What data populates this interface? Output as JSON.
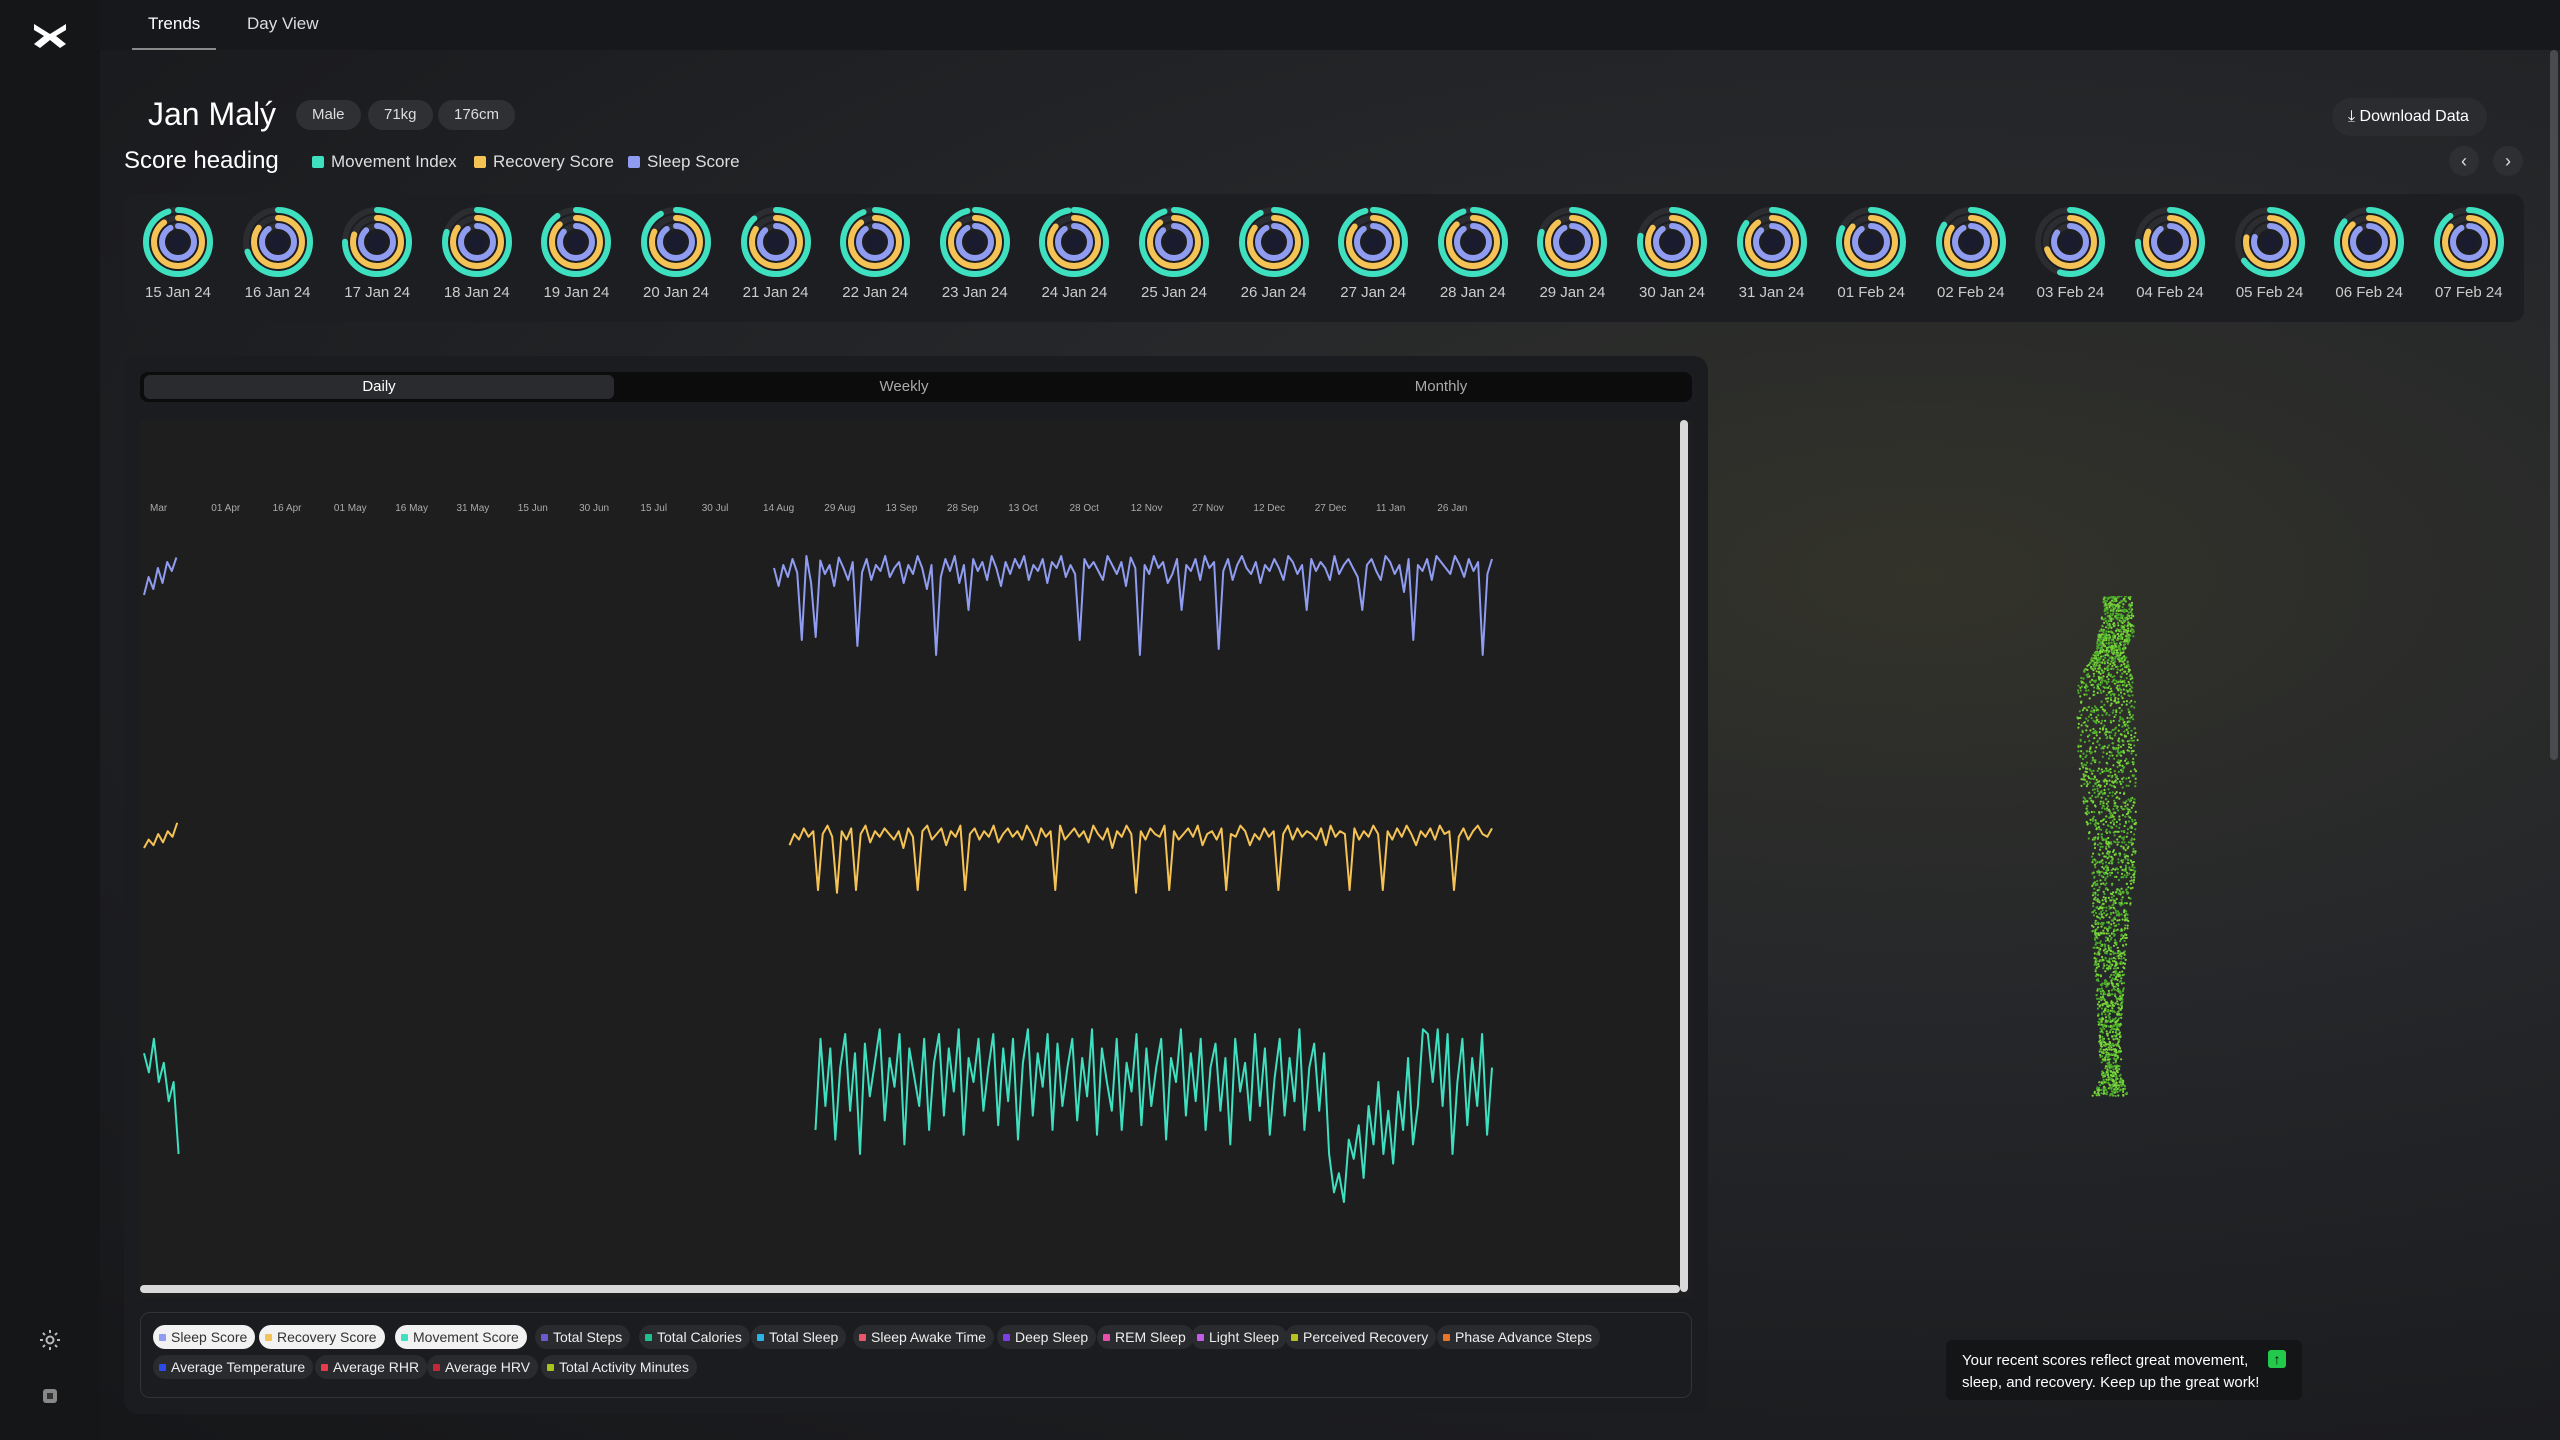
{
  "tabs": [
    "Trends",
    "Day View"
  ],
  "user": {
    "name": "Jan Malý",
    "chips": [
      "Male",
      "71kg",
      "176cm"
    ]
  },
  "download_label": "Download Data",
  "score_heading": "Score heading",
  "legend": [
    {
      "label": "Movement Index",
      "color": "#3fe0c0"
    },
    {
      "label": "Recovery Score",
      "color": "#f5c355"
    },
    {
      "label": "Sleep Score",
      "color": "#8f9cf0"
    }
  ],
  "rings": [
    {
      "date": "15 Jan 24",
      "movement": 0.95,
      "recovery": 0.9,
      "sleep": 0.92
    },
    {
      "date": "16 Jan 24",
      "movement": 0.7,
      "recovery": 0.85,
      "sleep": 0.9
    },
    {
      "date": "17 Jan 24",
      "movement": 0.75,
      "recovery": 0.8,
      "sleep": 0.88
    },
    {
      "date": "18 Jan 24",
      "movement": 0.8,
      "recovery": 0.85,
      "sleep": 0.9
    },
    {
      "date": "19 Jan 24",
      "movement": 0.9,
      "recovery": 0.88,
      "sleep": 0.86
    },
    {
      "date": "20 Jan 24",
      "movement": 0.92,
      "recovery": 0.82,
      "sleep": 0.9
    },
    {
      "date": "21 Jan 24",
      "movement": 0.88,
      "recovery": 0.84,
      "sleep": 0.88
    },
    {
      "date": "22 Jan 24",
      "movement": 0.94,
      "recovery": 0.9,
      "sleep": 0.9
    },
    {
      "date": "23 Jan 24",
      "movement": 0.96,
      "recovery": 0.88,
      "sleep": 0.92
    },
    {
      "date": "24 Jan 24",
      "movement": 0.97,
      "recovery": 0.86,
      "sleep": 0.9
    },
    {
      "date": "25 Jan 24",
      "movement": 0.95,
      "recovery": 0.9,
      "sleep": 0.88
    },
    {
      "date": "26 Jan 24",
      "movement": 0.93,
      "recovery": 0.85,
      "sleep": 0.92
    },
    {
      "date": "27 Jan 24",
      "movement": 0.96,
      "recovery": 0.86,
      "sleep": 0.9
    },
    {
      "date": "28 Jan 24",
      "movement": 0.95,
      "recovery": 0.88,
      "sleep": 0.9
    },
    {
      "date": "29 Jan 24",
      "movement": 0.8,
      "recovery": 0.9,
      "sleep": 0.92
    },
    {
      "date": "30 Jan 24",
      "movement": 0.78,
      "recovery": 0.85,
      "sleep": 0.9
    },
    {
      "date": "31 Jan 24",
      "movement": 0.85,
      "recovery": 0.9,
      "sleep": 0.88
    },
    {
      "date": "01 Feb 24",
      "movement": 0.82,
      "recovery": 0.86,
      "sleep": 0.9
    },
    {
      "date": "02 Feb 24",
      "movement": 0.84,
      "recovery": 0.85,
      "sleep": 0.92
    },
    {
      "date": "03 Feb 24",
      "movement": 0.55,
      "recovery": 0.7,
      "sleep": 0.85
    },
    {
      "date": "04 Feb 24",
      "movement": 0.75,
      "recovery": 0.82,
      "sleep": 0.9
    },
    {
      "date": "05 Feb 24",
      "movement": 0.65,
      "recovery": 0.78,
      "sleep": 0.8
    },
    {
      "date": "06 Feb 24",
      "movement": 0.86,
      "recovery": 0.88,
      "sleep": 0.9
    },
    {
      "date": "07 Feb 24",
      "movement": 0.9,
      "recovery": 0.86,
      "sleep": 0.92
    }
  ],
  "period_tabs": [
    "Daily",
    "Weekly",
    "Monthly"
  ],
  "chart_data": {
    "type": "line",
    "x_ticks": [
      "Mar",
      "01 Apr",
      "16 Apr",
      "01 May",
      "16 May",
      "31 May",
      "15 Jun",
      "30 Jun",
      "15 Jul",
      "30 Jul",
      "14 Aug",
      "29 Aug",
      "13 Sep",
      "28 Sep",
      "13 Oct",
      "28 Oct",
      "12 Nov",
      "27 Nov",
      "12 Dec",
      "27 Dec",
      "11 Jan",
      "26 Jan"
    ],
    "series": [
      {
        "name": "Sleep Score",
        "color": "#8f9cf0",
        "values": [
          70,
          82,
          74,
          88,
          78,
          92,
          86,
          95,
          null,
          null,
          null,
          null,
          null,
          null,
          null,
          null,
          null,
          null,
          null,
          null,
          null,
          null,
          null,
          null,
          null,
          null,
          null,
          null,
          null,
          null,
          null,
          null,
          null,
          null,
          null,
          null,
          null,
          null,
          null,
          null,
          null,
          null,
          null,
          null,
          null,
          null,
          null,
          null,
          null,
          null,
          null,
          null,
          null,
          null,
          null,
          null,
          null,
          null,
          null,
          null,
          null,
          null,
          null,
          null,
          null,
          null,
          null,
          null,
          null,
          null,
          null,
          null,
          null,
          null,
          null,
          null,
          null,
          null,
          null,
          null,
          null,
          null,
          null,
          null,
          null,
          null,
          null,
          null,
          null,
          null,
          null,
          null,
          null,
          null,
          null,
          null,
          null,
          null,
          null,
          null,
          null,
          null,
          null,
          null,
          null,
          null,
          null,
          null,
          null,
          null,
          null,
          null,
          null,
          null,
          null,
          null,
          null,
          null,
          null,
          null,
          null,
          null,
          null,
          null,
          null,
          null,
          null,
          null,
          null,
          null,
          null,
          null,
          null,
          null,
          null,
          null,
          88,
          76,
          90,
          82,
          94,
          85,
          40,
          96,
          78,
          42,
          93,
          84,
          90,
          76,
          95,
          88,
          80,
          92,
          36,
          85,
          94,
          80,
          90,
          86,
          96,
          82,
          88,
          92,
          78,
          90,
          84,
          96,
          88,
          74,
          90,
          30,
          82,
          94,
          86,
          96,
          78,
          90,
          60,
          94,
          86,
          92,
          80,
          96,
          88,
          76,
          92,
          84,
          94,
          88,
          96,
          80,
          90,
          86,
          94,
          78,
          92,
          88,
          96,
          82,
          90,
          84,
          40,
          94,
          88,
          92,
          86,
          80,
          96,
          90,
          84,
          92,
          76,
          95,
          88,
          30,
          90,
          84,
          96,
          88,
          92,
          78,
          84,
          94,
          60,
          90,
          86,
          94,
          80,
          96,
          88,
          92,
          34,
          86,
          94,
          80,
          90,
          96,
          88,
          84,
          92,
          78,
          90,
          86,
          94,
          88,
          80,
          96,
          92,
          84,
          90,
          60,
          94,
          86,
          92,
          88,
          80,
          96,
          84,
          90,
          94,
          88,
          82,
          60,
          90,
          94,
          86,
          80,
          96,
          92,
          84,
          90,
          72,
          94,
          40,
          90,
          86,
          94,
          80,
          96,
          92,
          88,
          84,
          96,
          90,
          82,
          94,
          86,
          92,
          30,
          84,
          94
        ]
      },
      {
        "name": "Recovery Score",
        "color": "#f5c355",
        "values": [
          60,
          66,
          62,
          70,
          64,
          72,
          68,
          78,
          null,
          null,
          null,
          null,
          null,
          null,
          null,
          null,
          null,
          null,
          null,
          null,
          null,
          null,
          null,
          null,
          null,
          null,
          null,
          null,
          null,
          null,
          null,
          null,
          null,
          null,
          null,
          null,
          null,
          null,
          null,
          null,
          null,
          null,
          null,
          null,
          null,
          null,
          null,
          null,
          null,
          null,
          null,
          null,
          null,
          null,
          null,
          null,
          null,
          null,
          null,
          null,
          null,
          null,
          null,
          null,
          null,
          null,
          null,
          null,
          null,
          null,
          null,
          null,
          null,
          null,
          null,
          null,
          null,
          null,
          null,
          null,
          null,
          null,
          null,
          null,
          null,
          null,
          null,
          null,
          null,
          null,
          null,
          null,
          null,
          null,
          null,
          null,
          null,
          null,
          null,
          null,
          null,
          null,
          null,
          null,
          null,
          null,
          null,
          null,
          null,
          null,
          null,
          null,
          null,
          null,
          null,
          null,
          null,
          null,
          null,
          null,
          null,
          null,
          null,
          null,
          null,
          null,
          null,
          null,
          null,
          null,
          null,
          null,
          null,
          null,
          null,
          null,
          62,
          70,
          66,
          74,
          68,
          72,
          30,
          70,
          76,
          68,
          28,
          72,
          66,
          74,
          30,
          70,
          76,
          64,
          72,
          68,
          74,
          70,
          66,
          72,
          60,
          74,
          68,
          30,
          72,
          76,
          66,
          70,
          74,
          62,
          72,
          68,
          76,
          30,
          70,
          74,
          66,
          72,
          68,
          76,
          64,
          70,
          74,
          68,
          72,
          66,
          76,
          70,
          62,
          74,
          68,
          72,
          30,
          76,
          66,
          70,
          74,
          68,
          72,
          64,
          76,
          70,
          66,
          74,
          60,
          72,
          68,
          76,
          70,
          28,
          72,
          66,
          74,
          70,
          68,
          76,
          30,
          72,
          66,
          70,
          74,
          68,
          76,
          62,
          70,
          72,
          66,
          74,
          30,
          70,
          68,
          76,
          72,
          62,
          70,
          66,
          74,
          68,
          72,
          30,
          70,
          76,
          66,
          74,
          68,
          72,
          70,
          66,
          74,
          62,
          76,
          68,
          72,
          70,
          30,
          74,
          66,
          72,
          68,
          76,
          70,
          30,
          72,
          66,
          74,
          68,
          76,
          70,
          62,
          72,
          68,
          74,
          66,
          76,
          70,
          72,
          30,
          68,
          74,
          66,
          72,
          76,
          70,
          68,
          74
        ]
      },
      {
        "name": "Movement Score",
        "color": "#3fe0c0",
        "values": [
          82,
          74,
          88,
          70,
          78,
          62,
          70,
          40,
          null,
          null,
          null,
          null,
          null,
          null,
          null,
          null,
          null,
          null,
          null,
          null,
          null,
          null,
          null,
          null,
          null,
          null,
          null,
          null,
          null,
          null,
          null,
          null,
          null,
          null,
          null,
          null,
          null,
          null,
          null,
          null,
          null,
          null,
          null,
          null,
          null,
          null,
          null,
          null,
          null,
          null,
          null,
          null,
          null,
          null,
          null,
          null,
          null,
          null,
          null,
          null,
          null,
          null,
          null,
          null,
          null,
          null,
          null,
          null,
          null,
          null,
          null,
          null,
          null,
          null,
          null,
          null,
          null,
          null,
          null,
          null,
          null,
          null,
          null,
          null,
          null,
          null,
          null,
          null,
          null,
          null,
          null,
          null,
          null,
          null,
          null,
          null,
          null,
          null,
          null,
          null,
          null,
          null,
          null,
          null,
          null,
          null,
          null,
          null,
          null,
          null,
          null,
          null,
          null,
          null,
          null,
          null,
          null,
          null,
          null,
          null,
          null,
          null,
          null,
          null,
          null,
          null,
          null,
          null,
          null,
          null,
          null,
          null,
          null,
          null,
          null,
          null,
          50,
          88,
          60,
          84,
          46,
          76,
          90,
          58,
          82,
          40,
          86,
          64,
          78,
          92,
          54,
          80,
          68,
          90,
          44,
          84,
          72,
          60,
          88,
          50,
          78,
          90,
          56,
          84,
          66,
          92,
          48,
          80,
          70,
          88,
          58,
          76,
          90,
          52,
          84,
          62,
          88,
          46,
          78,
          92,
          56,
          82,
          68,
          90,
          50,
          86,
          60,
          76,
          88,
          54,
          80,
          64,
          92,
          48,
          84,
          70,
          58,
          88,
          50,
          78,
          66,
          90,
          52,
          84,
          60,
          76,
          88,
          46,
          80,
          70,
          92,
          56,
          82,
          62,
          88,
          50,
          76,
          86,
          58,
          80,
          44,
          88,
          66,
          78,
          54,
          90,
          60,
          84,
          48,
          72,
          88,
          56,
          80,
          62,
          92,
          50,
          76,
          86,
          58,
          82,
          40,
          24,
          32,
          20,
          46,
          38,
          52,
          30,
          60,
          44,
          70,
          40,
          58,
          36,
          66,
          50,
          80,
          44,
          60,
          92,
          90,
          70,
          92,
          60,
          90,
          40,
          70,
          88,
          52,
          80,
          60,
          90,
          48,
          76
        ]
      }
    ]
  },
  "metrics": [
    {
      "label": "Sleep Score",
      "color": "#8f9cf0",
      "on": true
    },
    {
      "label": "Recovery Score",
      "color": "#f5c355",
      "on": true
    },
    {
      "label": "Movement Score",
      "color": "#3fe0c0",
      "on": true
    },
    {
      "label": "Total Steps",
      "color": "#6a5acd",
      "on": false
    },
    {
      "label": "Total Calories",
      "color": "#1ec28b",
      "on": false
    },
    {
      "label": "Total Sleep",
      "color": "#2ab4e8",
      "on": false
    },
    {
      "label": "Sleep Awake Time",
      "color": "#e8576a",
      "on": false
    },
    {
      "label": "Deep Sleep",
      "color": "#7b3fe4",
      "on": false
    },
    {
      "label": "REM Sleep",
      "color": "#e84fa8",
      "on": false
    },
    {
      "label": "Light Sleep",
      "color": "#c45ce8",
      "on": false
    },
    {
      "label": "Perceived Recovery",
      "color": "#b7c21e",
      "on": false
    },
    {
      "label": "Phase Advance Steps",
      "color": "#e8742a",
      "on": false
    },
    {
      "label": "Average Temperature",
      "color": "#2a4be8",
      "on": false
    },
    {
      "label": "Average RHR",
      "color": "#e83a4a",
      "on": false
    },
    {
      "label": "Average HRV",
      "color": "#c0283c",
      "on": false
    },
    {
      "label": "Total Activity Minutes",
      "color": "#a8c21e",
      "on": false
    }
  ],
  "tip": "Your recent scores reflect great movement, sleep, and recovery. Keep up the great work!"
}
